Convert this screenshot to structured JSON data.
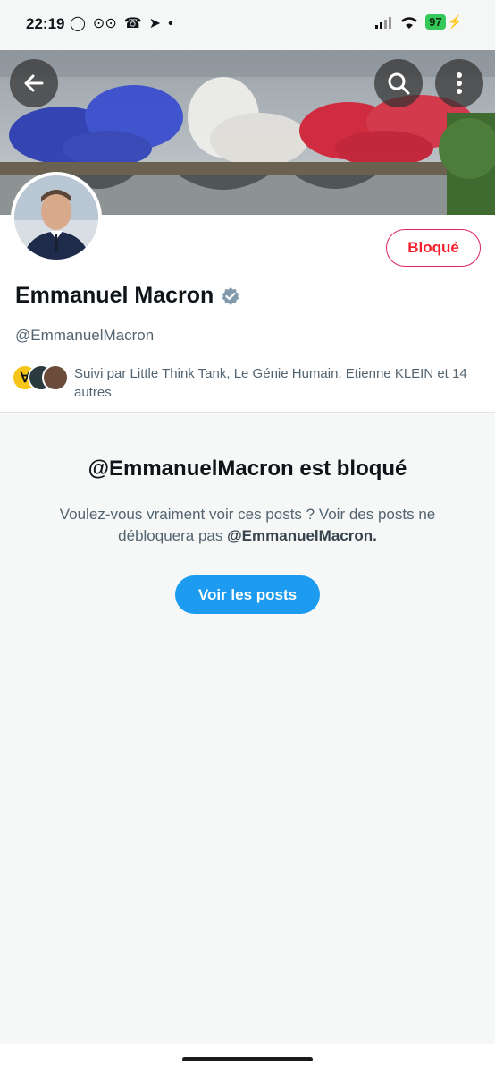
{
  "status": {
    "time": "22:19",
    "battery": "97",
    "left_icons": [
      "whatsapp-icon",
      "voicemail-icon",
      "missed-call-icon",
      "telegram-icon",
      "dot-icon"
    ]
  },
  "profile": {
    "name": "Emmanuel Macron",
    "handle": "@EmmanuelMacron",
    "block_button": "Bloqué",
    "followed_by": "Suivi par Little Think Tank, Le Génie Humain, Etienne KLEIN et 14 autres"
  },
  "blocked": {
    "title": "@EmmanuelMacron est bloqué",
    "desc_prefix": "Voulez-vous vraiment voir ces posts ? Voir des posts ne débloquera pas",
    "desc_handle": "@EmmanuelMacron.",
    "button": "Voir les posts"
  },
  "colors": {
    "accent": "#1d9bf0",
    "blocked_red": "#f4212e",
    "verified": "#829aab"
  }
}
